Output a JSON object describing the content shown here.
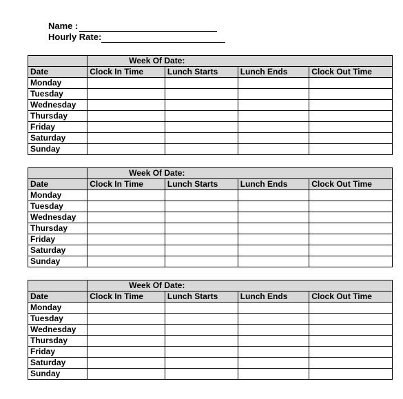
{
  "header": {
    "name_label": "Name :",
    "hourly_rate_label": "Hourly Rate:"
  },
  "week_of_date_label": "Week Of Date:",
  "columns": {
    "date": "Date",
    "clock_in": "Clock In Time",
    "lunch_starts": "Lunch Starts",
    "lunch_ends": "Lunch Ends",
    "clock_out": "Clock Out Time"
  },
  "days": [
    "Monday",
    "Tuesday",
    "Wednesday",
    "Thursday",
    "Friday",
    "Saturday",
    "Sunday"
  ],
  "weeks": [
    {
      "week_of": "",
      "rows": [
        {
          "clock_in": "",
          "lunch_starts": "",
          "lunch_ends": "",
          "clock_out": ""
        },
        {
          "clock_in": "",
          "lunch_starts": "",
          "lunch_ends": "",
          "clock_out": ""
        },
        {
          "clock_in": "",
          "lunch_starts": "",
          "lunch_ends": "",
          "clock_out": ""
        },
        {
          "clock_in": "",
          "lunch_starts": "",
          "lunch_ends": "",
          "clock_out": ""
        },
        {
          "clock_in": "",
          "lunch_starts": "",
          "lunch_ends": "",
          "clock_out": ""
        },
        {
          "clock_in": "",
          "lunch_starts": "",
          "lunch_ends": "",
          "clock_out": ""
        },
        {
          "clock_in": "",
          "lunch_starts": "",
          "lunch_ends": "",
          "clock_out": ""
        }
      ]
    },
    {
      "week_of": "",
      "rows": [
        {
          "clock_in": "",
          "lunch_starts": "",
          "lunch_ends": "",
          "clock_out": ""
        },
        {
          "clock_in": "",
          "lunch_starts": "",
          "lunch_ends": "",
          "clock_out": ""
        },
        {
          "clock_in": "",
          "lunch_starts": "",
          "lunch_ends": "",
          "clock_out": ""
        },
        {
          "clock_in": "",
          "lunch_starts": "",
          "lunch_ends": "",
          "clock_out": ""
        },
        {
          "clock_in": "",
          "lunch_starts": "",
          "lunch_ends": "",
          "clock_out": ""
        },
        {
          "clock_in": "",
          "lunch_starts": "",
          "lunch_ends": "",
          "clock_out": ""
        },
        {
          "clock_in": "",
          "lunch_starts": "",
          "lunch_ends": "",
          "clock_out": ""
        }
      ]
    },
    {
      "week_of": "",
      "rows": [
        {
          "clock_in": "",
          "lunch_starts": "",
          "lunch_ends": "",
          "clock_out": ""
        },
        {
          "clock_in": "",
          "lunch_starts": "",
          "lunch_ends": "",
          "clock_out": ""
        },
        {
          "clock_in": "",
          "lunch_starts": "",
          "lunch_ends": "",
          "clock_out": ""
        },
        {
          "clock_in": "",
          "lunch_starts": "",
          "lunch_ends": "",
          "clock_out": ""
        },
        {
          "clock_in": "",
          "lunch_starts": "",
          "lunch_ends": "",
          "clock_out": ""
        },
        {
          "clock_in": "",
          "lunch_starts": "",
          "lunch_ends": "",
          "clock_out": ""
        },
        {
          "clock_in": "",
          "lunch_starts": "",
          "lunch_ends": "",
          "clock_out": ""
        }
      ]
    }
  ]
}
